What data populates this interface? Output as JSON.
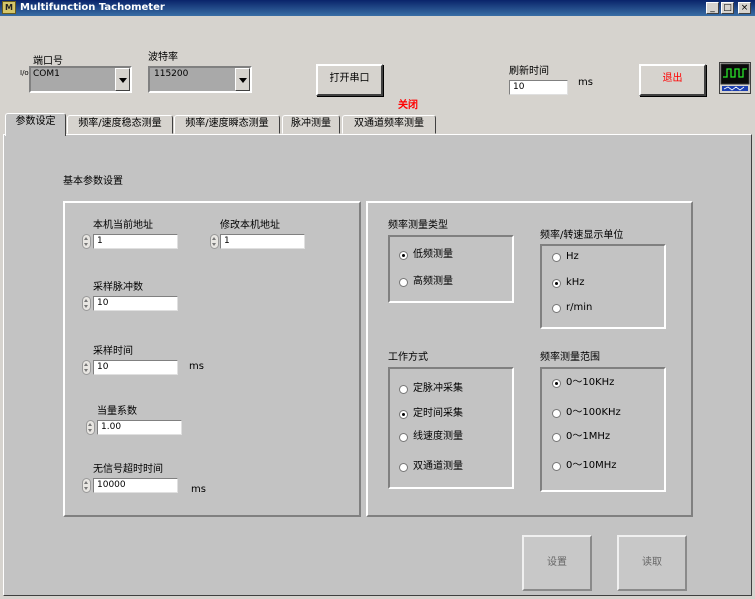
{
  "window": {
    "icon_text": "M",
    "title": "Multifunction Tachometer",
    "min_glyph": "_",
    "max_glyph": "□",
    "close_glyph": "×"
  },
  "serial": {
    "port_label": "端口号",
    "port_prefix": "I/o",
    "port_value": "COM1",
    "baud_label": "波特率",
    "baud_value": "115200",
    "open_button": "打开串口",
    "status_text": "关闭",
    "status_color": "#ff0000"
  },
  "refresh": {
    "label": "刷新时间",
    "value": "10",
    "unit": "ms"
  },
  "exit_button": "退出",
  "exit_color": "#ff0000",
  "tabs": [
    {
      "label": "参数设定",
      "active": true
    },
    {
      "label": "频率/速度稳态测量"
    },
    {
      "label": "频率/速度瞬态测量"
    },
    {
      "label": "脉冲测量"
    },
    {
      "label": "双通道频率测量"
    }
  ],
  "basic": {
    "section_title": "基本参数设置",
    "address_label": "本机当前地址",
    "address_value": "1",
    "modify_label": "修改本机地址",
    "modify_value": "1",
    "pulses_label": "采样脉冲数",
    "pulses_value": "10",
    "time_label": "采样时间",
    "time_value": "10",
    "time_unit": "ms",
    "coef_label": "当量系数",
    "coef_value": "1.00",
    "timeout_label": "无信号超时时间",
    "timeout_value": "10000",
    "timeout_unit": "ms"
  },
  "freq_type": {
    "title": "频率测量类型",
    "options": [
      "低频测量",
      "高频测量"
    ],
    "selected": 0
  },
  "unit": {
    "title": "频率/转速显示单位",
    "options": [
      "Hz",
      "kHz",
      "r/min"
    ],
    "selected": 1
  },
  "mode": {
    "title": "工作方式",
    "options": [
      "定脉冲采集",
      "定时间采集",
      "线速度测量",
      "双通道测量"
    ],
    "selected": 1
  },
  "range": {
    "title": "频率测量范围",
    "options": [
      "0～10KHz",
      "0～100KHz",
      "0～1MHz",
      "0～10MHz"
    ],
    "selected": 0
  },
  "actions": {
    "set_button": "设置",
    "read_button": "读取"
  }
}
